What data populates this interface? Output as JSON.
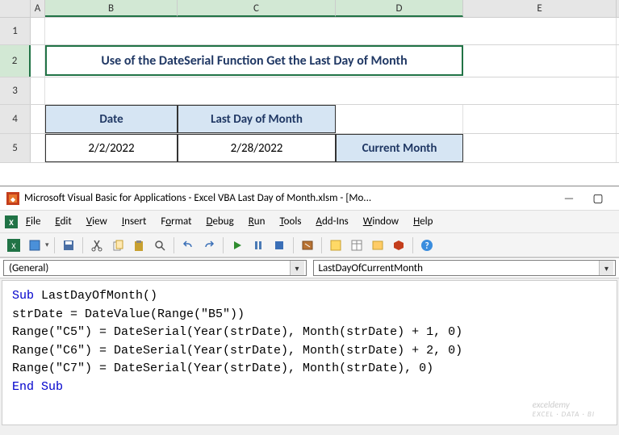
{
  "columns": {
    "A": "A",
    "B": "B",
    "C": "C",
    "D": "D",
    "E": "E"
  },
  "rows": {
    "r1": "1",
    "r2": "2",
    "r3": "3",
    "r4": "4",
    "r5": "5"
  },
  "title": "Use of the DateSerial Function Get the Last Day of Month",
  "headers": {
    "date": "Date",
    "lastDay": "Last Day of Month",
    "current": "Current Month"
  },
  "data": {
    "date": "2/2/2022",
    "lastDay": "2/28/2022"
  },
  "vba": {
    "title": "Microsoft Visual Basic for Applications - Excel VBA Last Day of Month.xlsm - [Mo...",
    "menu": {
      "file": "File",
      "edit": "Edit",
      "view": "View",
      "insert": "Insert",
      "format": "Format",
      "debug": "Debug",
      "run": "Run",
      "tools": "Tools",
      "addins": "Add-Ins",
      "window": "Window",
      "help": "Help"
    },
    "combo": {
      "obj": "(General)",
      "proc": "LastDayOfCurrentMonth"
    },
    "code": {
      "l1a": "Sub",
      "l1b": " LastDayOfMonth()",
      "l2": "strDate = DateValue(Range(\"B5\"))",
      "l3": "Range(\"C5\") = DateSerial(Year(strDate), Month(strDate) + 1, 0)",
      "l4": "Range(\"C6\") = DateSerial(Year(strDate), Month(strDate) + 2, 0)",
      "l5": "Range(\"C7\") = DateSerial(Year(strDate), Month(strDate), 0)",
      "l6": "End Sub"
    }
  },
  "watermark": {
    "main": "exceldemy",
    "sub": "EXCEL · DATA · BI"
  }
}
